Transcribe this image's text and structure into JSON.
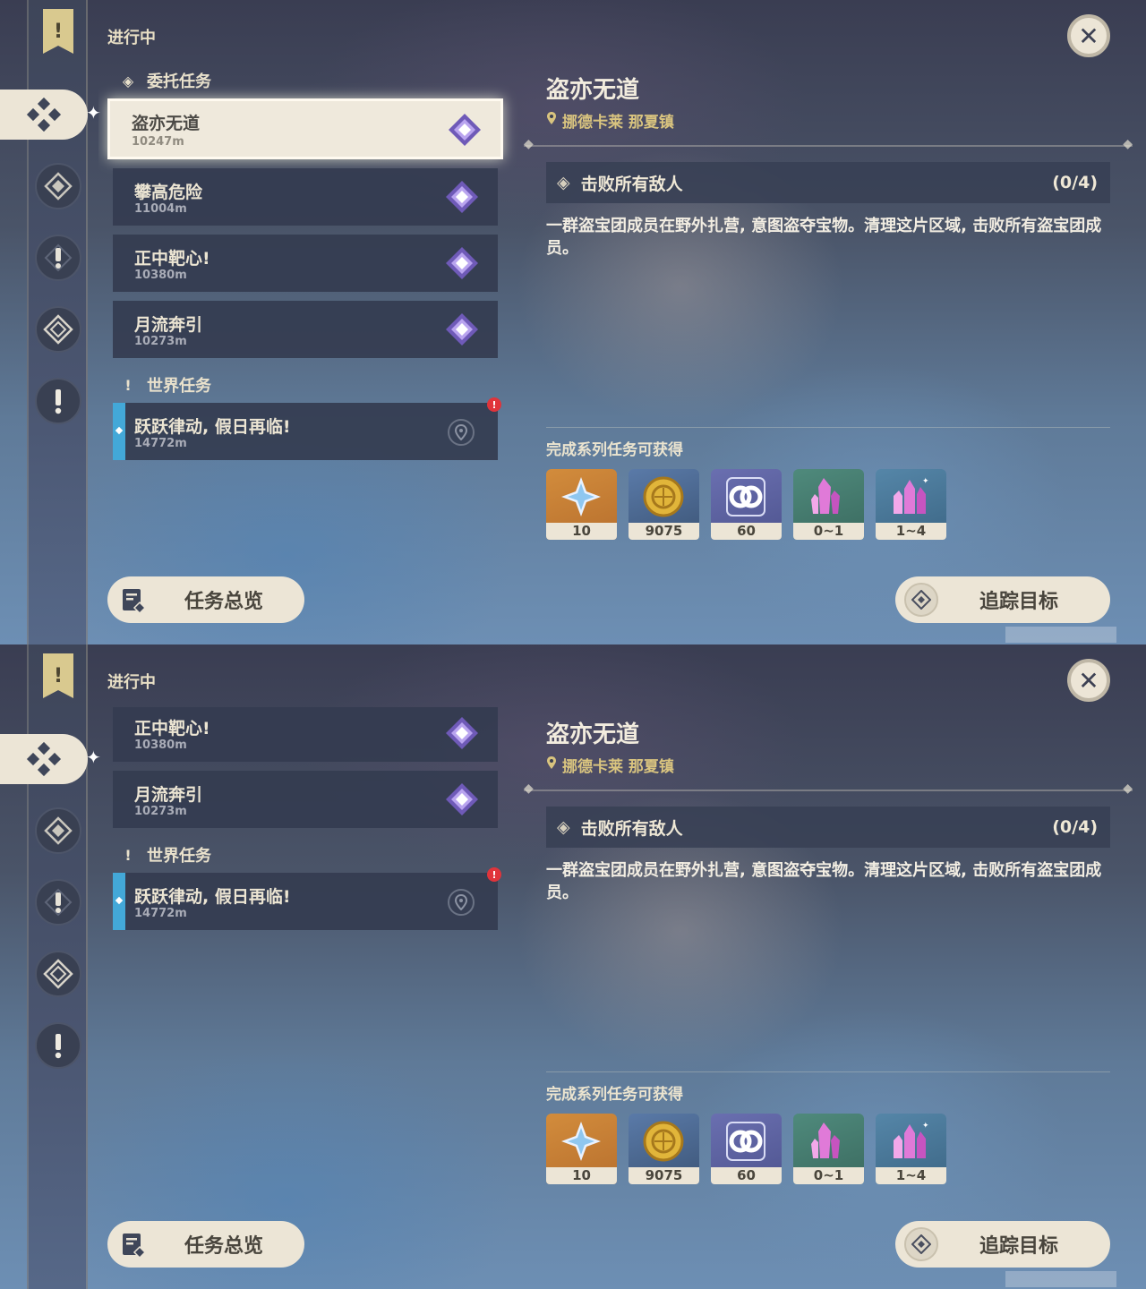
{
  "panel": {
    "section_title": "进行中",
    "categories": {
      "commission": "委托任务",
      "world": "世界任务"
    },
    "commission_quests": [
      {
        "title": "盗亦无道",
        "distance": "10247m"
      },
      {
        "title": "攀高危险",
        "distance": "11004m"
      },
      {
        "title": "正中靶心!",
        "distance": "10380m"
      },
      {
        "title": "月流奔引",
        "distance": "10273m"
      }
    ],
    "world_quests": [
      {
        "title": "跃跃律动, 假日再临!",
        "distance": "14772m",
        "alert": "!"
      }
    ]
  },
  "rail": {
    "icons": [
      "banner-icon",
      "commission-icon",
      "archon-icon",
      "world-quest-icon",
      "story-icon",
      "alert-icon"
    ],
    "banner_glyph": "!"
  },
  "detail": {
    "title": "盗亦无道",
    "location": "挪德卡莱 那夏镇",
    "objective": "击败所有敌人",
    "progress": "(0/4)",
    "description": "一群盗宝团成员在野外扎营, 意图盗夺宝物。清理这片区域, 击败所有盗宝团成员。",
    "rewards_label": "完成系列任务可获得",
    "rewards": [
      {
        "icon": "primogem-icon",
        "count": "10"
      },
      {
        "icon": "mora-icon",
        "count": "9075"
      },
      {
        "icon": "fellowship-icon",
        "count": "60"
      },
      {
        "icon": "crystal-icon",
        "count": "0~1"
      },
      {
        "icon": "crystal-cluster-icon",
        "count": "1~4"
      }
    ]
  },
  "buttons": {
    "overview": "任务总览",
    "track": "追踪目标",
    "close": "✕"
  },
  "colors": {
    "accent_gold": "#d9c47f",
    "panel_cream": "#ece5d6",
    "world_quest_bar": "#43a8d8",
    "alert_red": "#e0343b"
  }
}
